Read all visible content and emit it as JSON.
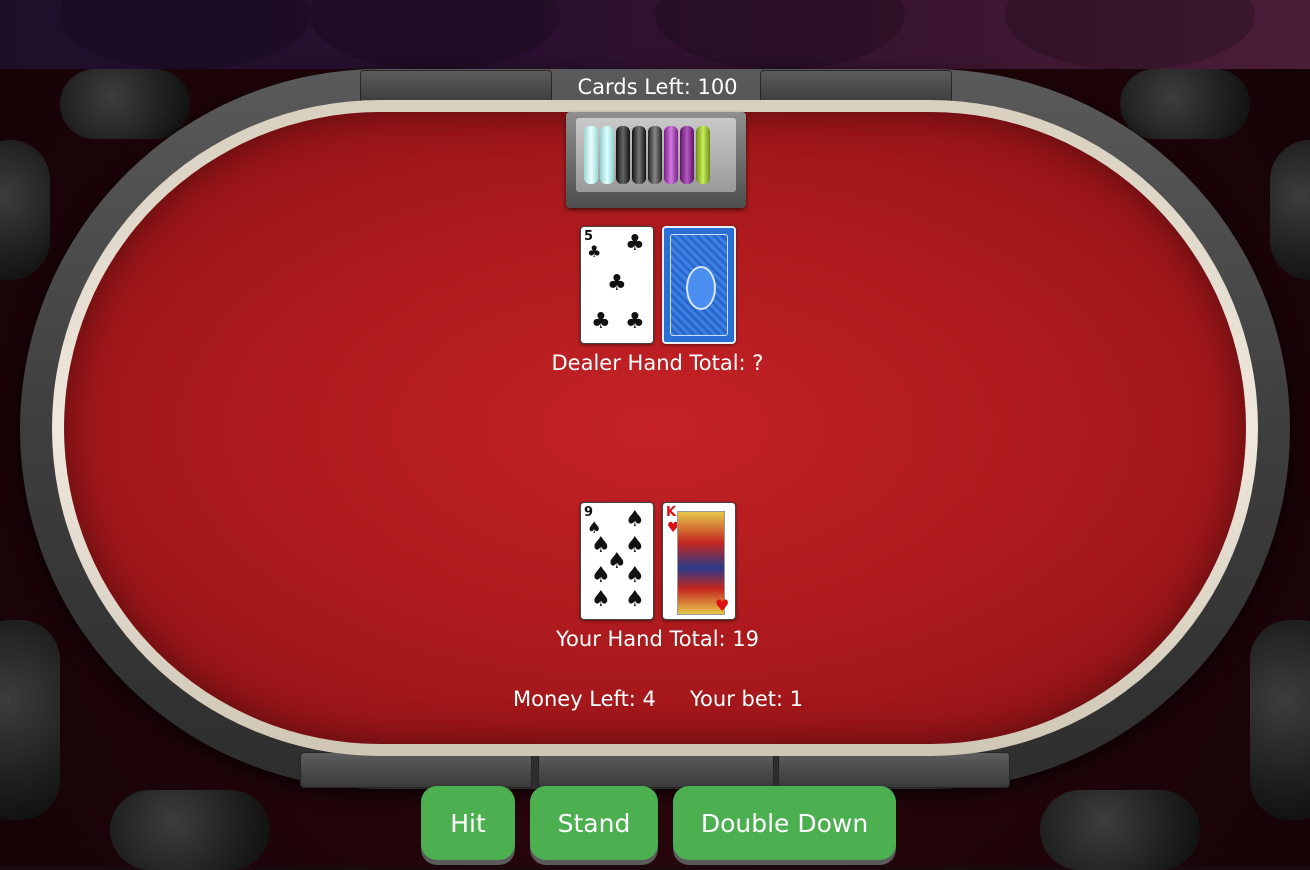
{
  "table": {
    "cards_left_label": "Cards Left: 100",
    "felt_color": "#b81d21"
  },
  "dealer": {
    "cards": [
      {
        "rank": "5",
        "suit": "clubs",
        "face_up": true
      },
      {
        "rank": "",
        "suit": "",
        "face_up": false
      }
    ],
    "total_label": "Dealer Hand Total: ?"
  },
  "player": {
    "cards": [
      {
        "rank": "9",
        "suit": "spades",
        "face_up": true
      },
      {
        "rank": "K",
        "suit": "hearts",
        "face_up": true
      }
    ],
    "total_label": "Your Hand Total: 19"
  },
  "status": {
    "money_label": "Money Left: 4",
    "bet_label": "Your bet: 1"
  },
  "actions": {
    "hit_label": "Hit",
    "stand_label": "Stand",
    "double_down_label": "Double Down",
    "button_color": "#4caf50"
  },
  "icons": {
    "chip_tray": "chip-tray-icon",
    "card_back": "card-back-icon"
  }
}
